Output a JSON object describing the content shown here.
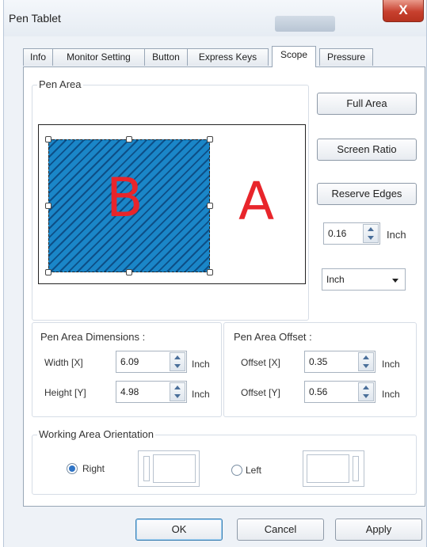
{
  "window": {
    "title": "Pen Tablet",
    "close_label": "X"
  },
  "tabs": [
    {
      "label": "Info",
      "active": false
    },
    {
      "label": "Monitor Setting",
      "active": false
    },
    {
      "label": "Button",
      "active": false
    },
    {
      "label": "Express Keys",
      "active": false
    },
    {
      "label": "Scope",
      "active": true
    },
    {
      "label": "Pressure",
      "active": false
    }
  ],
  "pen_area": {
    "group_label": "Pen Area",
    "map_label_outer": "A",
    "map_label_inner": "B",
    "full_area_button": "Full Area",
    "screen_ratio_button": "Screen Ratio",
    "reserve_edges_button": "Reserve Edges",
    "reserve_value": "0.16",
    "reserve_unit": "Inch",
    "unit_select": "Inch"
  },
  "dimensions": {
    "group_label": "Pen Area Dimensions :",
    "width_label": "Width [X]",
    "width_value": "6.09",
    "width_unit": "Inch",
    "height_label": "Height [Y]",
    "height_value": "4.98",
    "height_unit": "Inch"
  },
  "offset": {
    "group_label": "Pen Area Offset :",
    "x_label": "Offset [X]",
    "x_value": "0.35",
    "x_unit": "Inch",
    "y_label": "Offset [Y]",
    "y_value": "0.56",
    "y_unit": "Inch"
  },
  "orientation": {
    "group_label": "Working Area Orientation",
    "right_label": "Right",
    "left_label": "Left",
    "selected": "Right"
  },
  "footer": {
    "ok": "OK",
    "cancel": "Cancel",
    "apply": "Apply"
  },
  "colors": {
    "pen_area_fill": "#1a86c8",
    "map_letter": "#e8252b",
    "close_button": "#c7402e"
  }
}
